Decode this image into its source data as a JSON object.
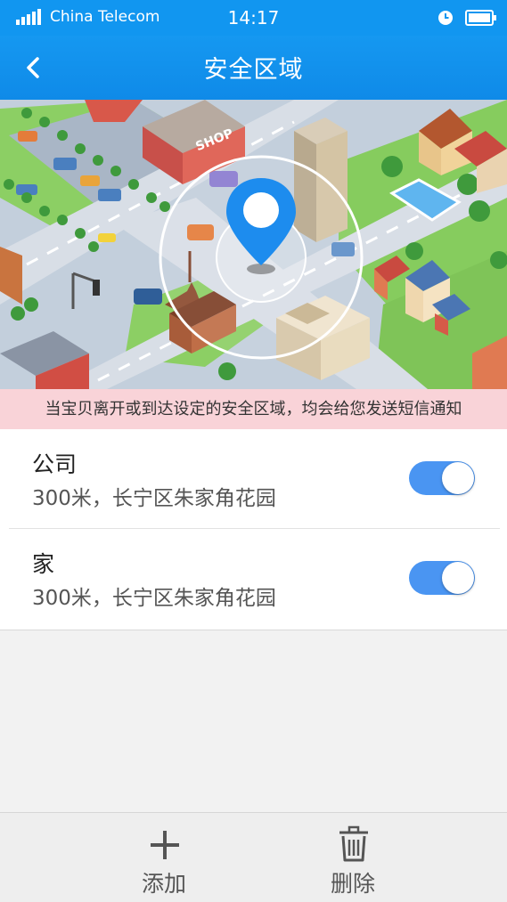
{
  "status_bar": {
    "carrier": "China Telecom",
    "time": "14:17",
    "icons": [
      "signal-icon",
      "alarm-icon",
      "battery-icon"
    ]
  },
  "nav": {
    "title": "安全区域",
    "back_icon": "chevron-left-icon"
  },
  "hero": {
    "sign_text": "SHOP",
    "marker_icon": "location-pin-icon"
  },
  "notice": "当宝贝离开或到达设定的安全区域，均会给您发送短信通知",
  "zones": [
    {
      "name": "公司",
      "description": "300米，长宁区朱家角花园",
      "enabled": true
    },
    {
      "name": "家",
      "description": "300米，长宁区朱家角花园",
      "enabled": true
    }
  ],
  "bottom_bar": {
    "add_label": "添加",
    "delete_label": "删除",
    "add_icon": "plus-icon",
    "delete_icon": "trash-icon"
  },
  "colors": {
    "header_blue": "#1196f0",
    "toggle_on": "#4a95f2",
    "notice_bg": "#f9d3d8"
  }
}
